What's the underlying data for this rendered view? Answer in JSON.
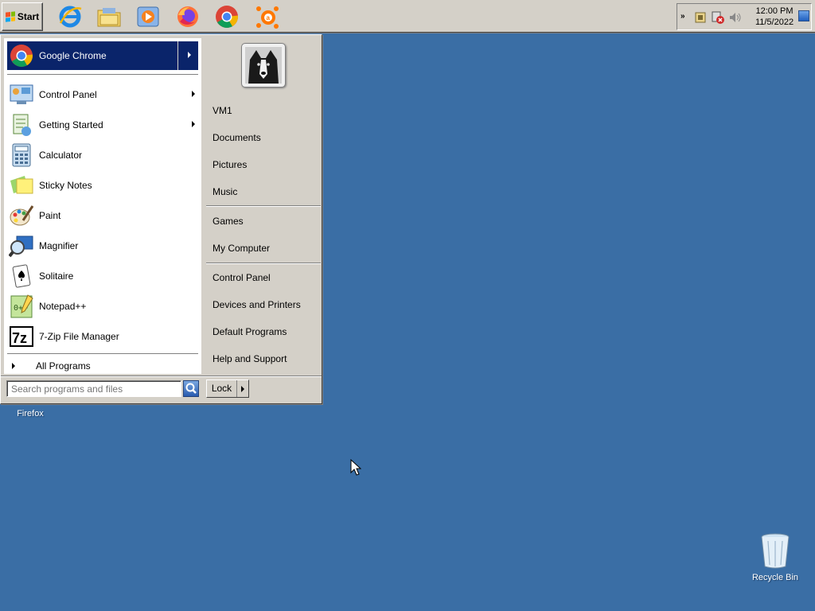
{
  "taskbar": {
    "start_label": "Start",
    "quick_launch": [
      {
        "name": "internet-explorer-icon"
      },
      {
        "name": "folder-explorer-icon"
      },
      {
        "name": "media-player-icon"
      },
      {
        "name": "firefox-icon"
      },
      {
        "name": "chrome-icon"
      },
      {
        "name": "avast-icon"
      }
    ],
    "tray": {
      "chevron": "»",
      "time": "12:00 PM",
      "date": "11/5/2022"
    }
  },
  "desktop": {
    "firefox_label": "Firefox",
    "recycle_bin_label": "Recycle Bin",
    "background_color": "#3a6ea5"
  },
  "start_menu": {
    "pinned": {
      "label": "Google Chrome",
      "icon": "chrome-icon"
    },
    "items": [
      {
        "label": "Control Panel",
        "icon": "control-panel-icon",
        "has_submenu": true
      },
      {
        "label": "Getting Started",
        "icon": "getting-started-icon",
        "has_submenu": true
      },
      {
        "label": "Calculator",
        "icon": "calculator-icon",
        "has_submenu": false
      },
      {
        "label": "Sticky Notes",
        "icon": "sticky-notes-icon",
        "has_submenu": false
      },
      {
        "label": "Paint",
        "icon": "paint-icon",
        "has_submenu": false
      },
      {
        "label": "Magnifier",
        "icon": "magnifier-icon",
        "has_submenu": false
      },
      {
        "label": "Solitaire",
        "icon": "solitaire-icon",
        "has_submenu": false
      },
      {
        "label": "Notepad++",
        "icon": "notepadpp-icon",
        "has_submenu": false
      },
      {
        "label": "7-Zip File Manager",
        "icon": "7zip-icon",
        "has_submenu": false
      }
    ],
    "all_programs": "All Programs",
    "search_placeholder": "Search programs and files",
    "right": {
      "user": "VM1",
      "group1": [
        "Documents",
        "Pictures",
        "Music"
      ],
      "group2": [
        "Games",
        "My Computer"
      ],
      "group3": [
        "Control Panel",
        "Devices and Printers",
        "Default Programs",
        "Help and Support"
      ]
    },
    "lock_label": "Lock",
    "highlight_color": "#0a246a"
  }
}
